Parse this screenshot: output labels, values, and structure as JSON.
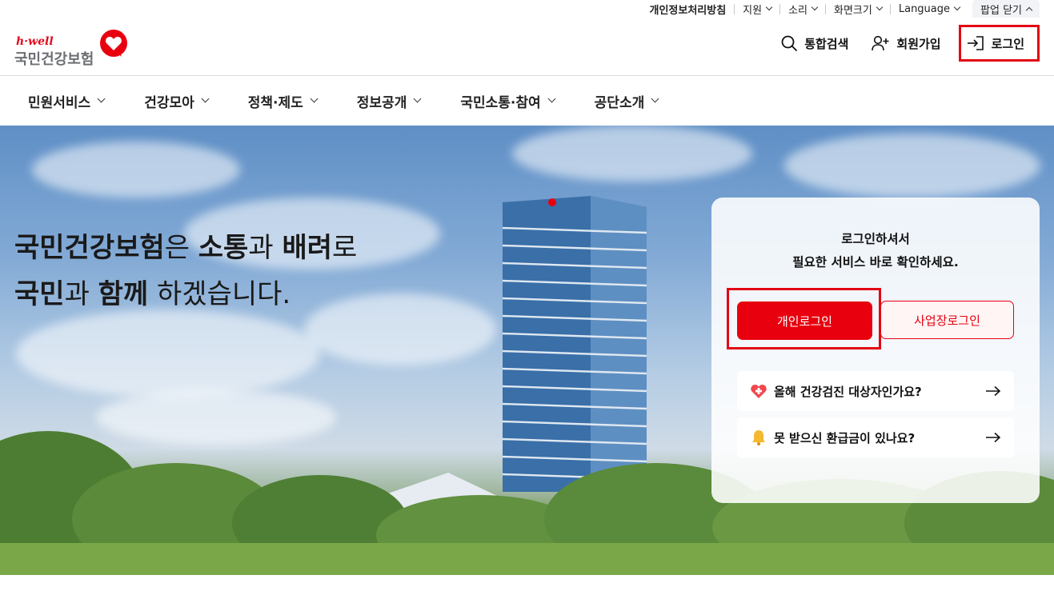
{
  "utility": {
    "privacy": "개인정보처리방침",
    "support": "지원",
    "sound": "소리",
    "screen_size": "화면크기",
    "language": "Language",
    "popup_close": "팝업 닫기"
  },
  "logo": {
    "wordmark": "h·well",
    "name": "국민건강보험"
  },
  "header_actions": {
    "search": "통합검색",
    "signup": "회원가입",
    "login": "로그인"
  },
  "nav": [
    {
      "label": "민원서비스"
    },
    {
      "label": "건강모아"
    },
    {
      "label": "정책·제도"
    },
    {
      "label": "정보공개"
    },
    {
      "label": "국민소통·참여"
    },
    {
      "label": "공단소개"
    }
  ],
  "hero": {
    "line1": {
      "b1": "국민건강보험",
      "t1": "은 ",
      "b2": "소통",
      "t2": "과 ",
      "b3": "배려",
      "t3": "로"
    },
    "line2": {
      "b1": "국민",
      "t1": "과 ",
      "b2": "함께",
      "t2": " 하겠습니다."
    }
  },
  "login_panel": {
    "message_line1": "로그인하셔서",
    "message_line2": "필요한 서비스 바로 확인하세요.",
    "personal_login": "개인로그인",
    "business_login": "사업장로그인",
    "links": [
      {
        "label": "올해 건강검진 대상자인가요?",
        "icon": "heart-plus-icon"
      },
      {
        "label": "못 받으신 환급금이 있나요?",
        "icon": "bell-icon"
      }
    ]
  },
  "colors": {
    "brand_red": "#E8000F",
    "highlight": "#E30613",
    "text": "#111111"
  }
}
